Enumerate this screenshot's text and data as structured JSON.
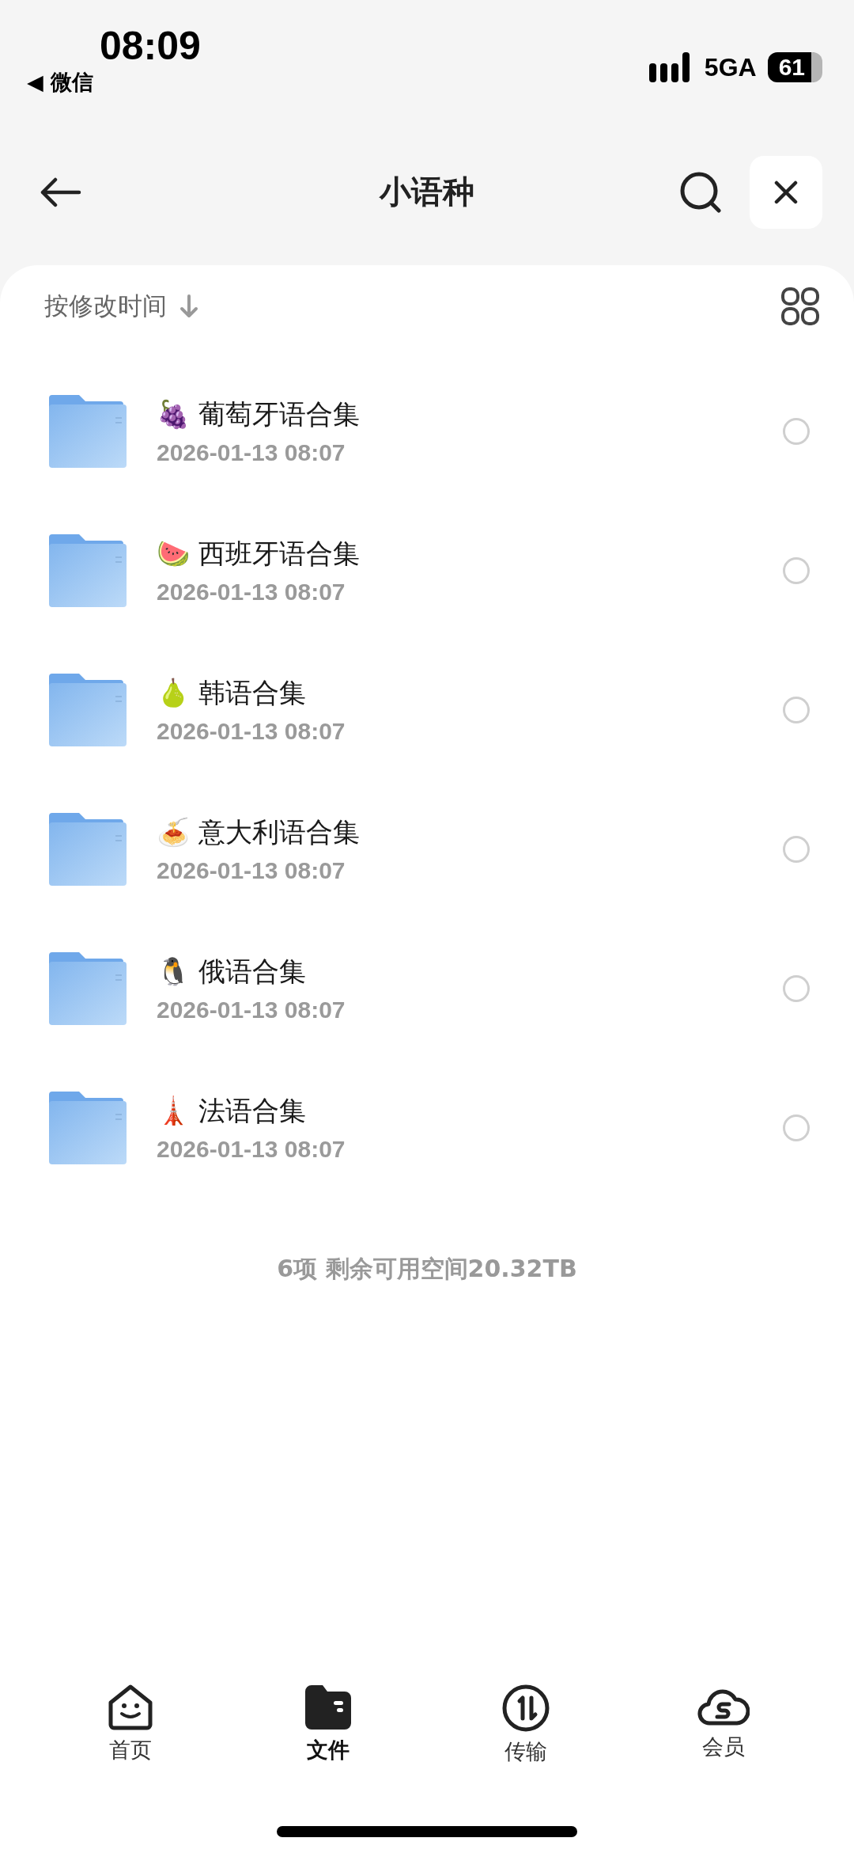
{
  "status_bar": {
    "time": "08:09",
    "back_app": "◀ 微信",
    "network": "5GA",
    "battery": "61"
  },
  "header": {
    "title": "小语种"
  },
  "sort": {
    "label": "按修改时间"
  },
  "files": [
    {
      "name": "🍇 葡萄牙语合集",
      "date": "2026-01-13 08:07",
      "selected": false
    },
    {
      "name": "🍉 西班牙语合集",
      "date": "2026-01-13 08:07",
      "selected": false
    },
    {
      "name": "🍐 韩语合集",
      "date": "2026-01-13 08:07",
      "selected": false
    },
    {
      "name": "🍝 意大利语合集",
      "date": "2026-01-13 08:07",
      "selected": false
    },
    {
      "name": "🐧 俄语合集",
      "date": "2026-01-13 08:07",
      "selected": false
    },
    {
      "name": "🗼 法语合集",
      "date": "2026-01-13 08:07",
      "selected": false
    }
  ],
  "summary": "6项 剩余可用空间20.32TB",
  "tabs": [
    {
      "kind": "home",
      "label": "首页",
      "selected": false
    },
    {
      "kind": "files",
      "label": "文件",
      "selected": true
    },
    {
      "kind": "transfer",
      "label": "传输",
      "selected": false
    },
    {
      "kind": "member",
      "label": "会员",
      "selected": false
    }
  ]
}
